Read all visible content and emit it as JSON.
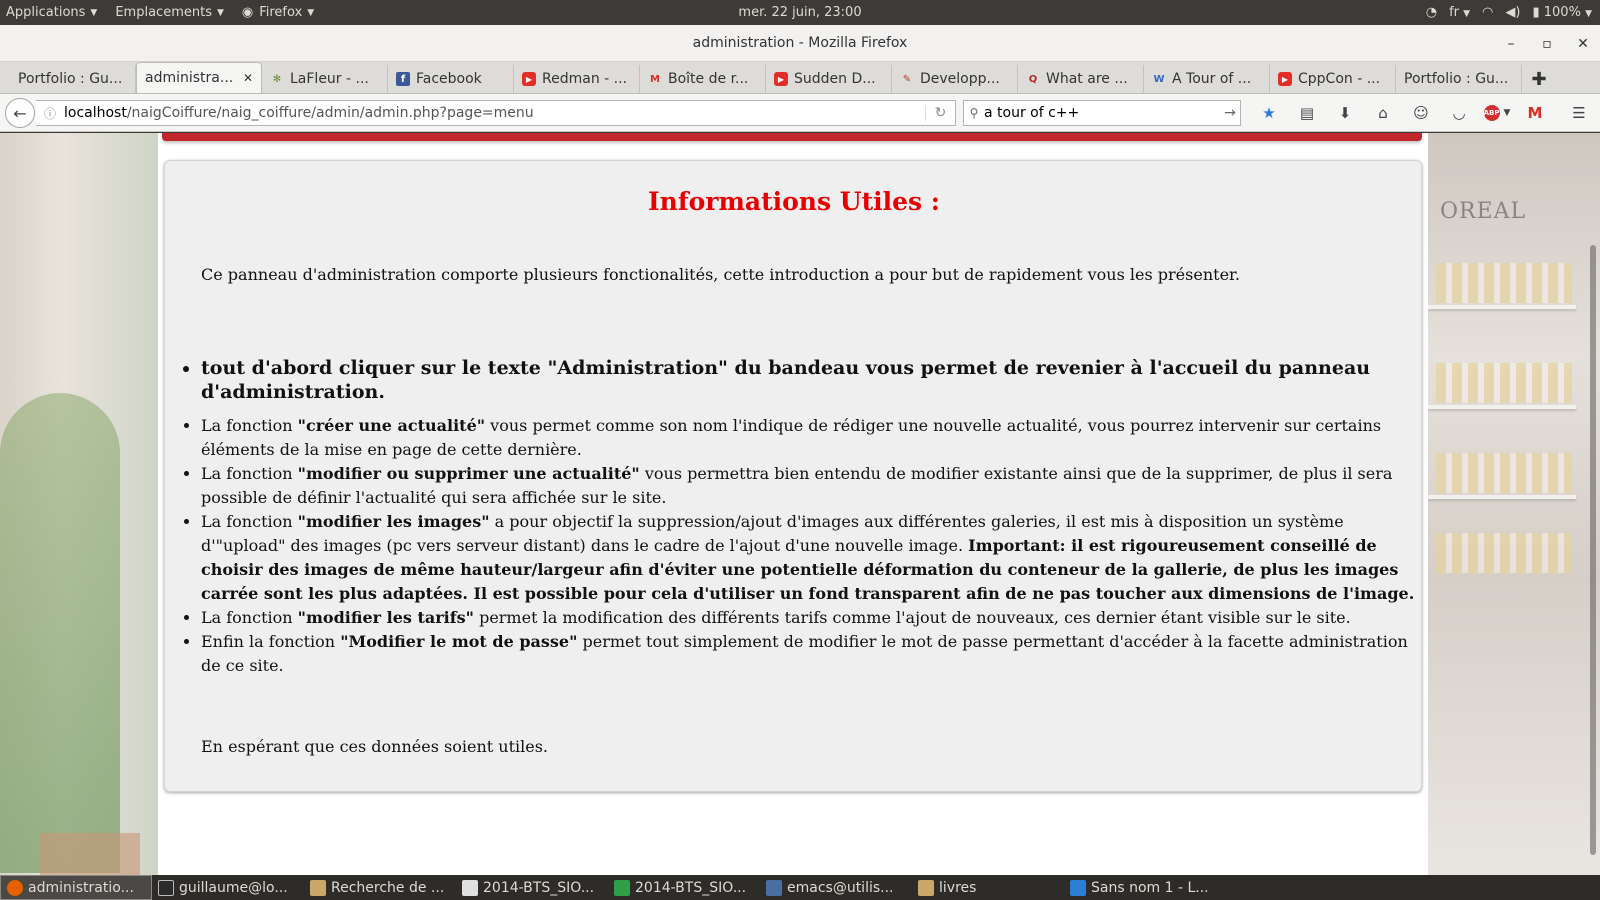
{
  "top_panel": {
    "applications": "Applications",
    "places": "Emplacements",
    "firefox": "Firefox",
    "clock": "mer. 22 juin, 23:00",
    "keyboard_layout": "fr",
    "battery": "100%"
  },
  "window": {
    "title": "administration - Mozilla Firefox",
    "minimize": "–",
    "maximize": "▫",
    "close": "✕"
  },
  "tabs": [
    {
      "label": "Portfolio : Gu...",
      "icon": "page-icon",
      "color": "#777777",
      "glyph": ""
    },
    {
      "label": "administra...",
      "icon": "page-icon",
      "color": "#777777",
      "glyph": "",
      "active": true
    },
    {
      "label": "LaFleur - ...",
      "icon": "leaf-icon",
      "color": "#6a8a2a",
      "glyph": "✻"
    },
    {
      "label": "Facebook",
      "icon": "facebook-icon",
      "color": "#3b5998",
      "glyph": "f"
    },
    {
      "label": "Redman - ...",
      "icon": "youtube-icon",
      "color": "#e52d27",
      "glyph": "▶"
    },
    {
      "label": "Boîte de r...",
      "icon": "gmail-icon",
      "color": "#d93025",
      "glyph": "M"
    },
    {
      "label": "Sudden D...",
      "icon": "youtube-icon",
      "color": "#e52d27",
      "glyph": "▶"
    },
    {
      "label": "Developp...",
      "icon": "developpez-icon",
      "color": "#c0392b",
      "glyph": "✎"
    },
    {
      "label": "What are ...",
      "icon": "quora-icon",
      "color": "#b92b27",
      "glyph": "Q"
    },
    {
      "label": "A Tour of ...",
      "icon": "wikipedia-icon",
      "color": "#3366cc",
      "glyph": "W"
    },
    {
      "label": "CppCon - ...",
      "icon": "youtube-icon",
      "color": "#e52d27",
      "glyph": "▶"
    },
    {
      "label": "Portfolio : Gu...",
      "icon": "page-icon",
      "color": "#777777",
      "glyph": ""
    }
  ],
  "tab_close": "✕",
  "new_tab": "✚",
  "nav": {
    "url_host": "localhost",
    "url_path": "/naigCoiffure/naig_coiffure/admin/admin.php?page=menu",
    "search_value": "a tour of c++"
  },
  "page": {
    "title": "Informations Utiles :",
    "intro": "Ce panneau d'administration comporte plusieurs fonctionalités, cette introduction a pour but de rapidement vous les présenter.",
    "lead_item": "tout d'abord cliquer sur le texte \"Administration\" du bandeau vous permet de revenier à l'accueil du panneau d'administration.",
    "items": [
      {
        "prefix": "La fonction ",
        "bold": "\"créer une actualité\"",
        "text": " vous permet comme son nom l'indique de rédiger une nouvelle actualité, vous pourrez intervenir sur certains éléments de la mise en page de cette dernière."
      },
      {
        "prefix": "La fonction ",
        "bold": "\"modifier ou supprimer une actualité\"",
        "text": " vous permettra bien entendu de modifier existante ainsi que de la supprimer, de plus il sera possible de définir l'actualité qui sera affichée sur le site."
      },
      {
        "prefix": "La fonction ",
        "bold": "\"modifier les images\"",
        "text": " a pour objectif la suppression/ajout d'images aux différentes galeries, il est mis à disposition un système d'\"upload\" des images (pc vers serveur distant) dans le cadre de l'ajout d'une nouvelle image. ",
        "bold2": "Important: il est rigoureusement conseillé de choisir des images de même hauteur/largeur afin d'éviter une potentielle déformation du conteneur de la gallerie, de plus les images carrée sont les plus adaptées. Il est possible pour cela d'utiliser un fond transparent afin de ne pas toucher aux dimensions de l'image."
      },
      {
        "prefix": "La fonction ",
        "bold": "\"modifier les tarifs\"",
        "text": " permet la modification des différents tarifs comme l'ajout de nouveaux, ces dernier étant visible sur le site."
      },
      {
        "prefix": "Enfin la fonction ",
        "bold": "\"Modifier le mot de passe\"",
        "text": " permet tout simplement de modifier le mot de passe permettant d'accéder à la facette administration de ce site."
      }
    ],
    "outro": "En espérant que ces données soient utiles.",
    "background_brand": "OREAL",
    "title_color": "#e60000",
    "header_color": "#c0262b"
  },
  "taskbar": [
    {
      "label": "administratio...",
      "icon": "firefox-icon",
      "color": "#e66000",
      "active": true
    },
    {
      "label": "guillaume@lo...",
      "icon": "terminal-icon",
      "color": "#2b2b2b"
    },
    {
      "label": "Recherche de ...",
      "icon": "folder-icon",
      "color": "#c9a86a"
    },
    {
      "label": "2014-BTS_SIO...",
      "icon": "pdf-icon",
      "color": "#e0e0e0"
    },
    {
      "label": "2014-BTS_SIO...",
      "icon": "spreadsheet-icon",
      "color": "#2e9e48"
    },
    {
      "label": "emacs@utilis...",
      "icon": "emacs-icon",
      "color": "#4a6fa5"
    },
    {
      "label": "livres",
      "icon": "folder-icon",
      "color": "#c9a86a"
    },
    {
      "label": "Sans nom 1 - L...",
      "icon": "writer-icon",
      "color": "#2a7fd4"
    }
  ]
}
